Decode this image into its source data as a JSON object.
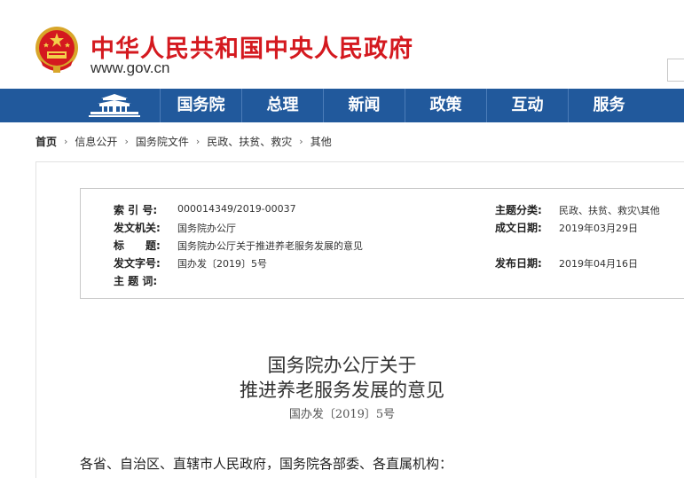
{
  "header": {
    "site_title": "中华人民共和国中央人民政府",
    "site_url": "www.gov.cn"
  },
  "nav": {
    "items": [
      "国务院",
      "总理",
      "新闻",
      "政策",
      "互动",
      "服务"
    ]
  },
  "breadcrumb": {
    "items": [
      "首页",
      "信息公开",
      "国务院文件",
      "民政、扶贫、救灾",
      "其他"
    ]
  },
  "metadata": {
    "index_no_label": "索 引 号:",
    "index_no": "000014349/2019-00037",
    "issuer_label": "发文机关:",
    "issuer": "国务院办公厅",
    "title_label": "标　　题:",
    "title": "国务院办公厅关于推进养老服务发展的意见",
    "doc_no_label": "发文字号:",
    "doc_no": "国办发〔2019〕5号",
    "keywords_label": "主 题 词:",
    "keywords": "",
    "category_label": "主题分类:",
    "category": "民政、扶贫、救灾\\其他",
    "created_label": "成文日期:",
    "created": "2019年03月29日",
    "published_label": "发布日期:",
    "published": "2019年04月16日"
  },
  "document": {
    "title_line1": "国务院办公厅关于",
    "title_line2": "推进养老服务发展的意见",
    "number": "国办发〔2019〕5号",
    "addressee": "各省、自治区、直辖市人民政府，国务院各部委、各直属机构："
  },
  "colors": {
    "brand_red": "#d4191f",
    "nav_blue": "#21599c"
  }
}
